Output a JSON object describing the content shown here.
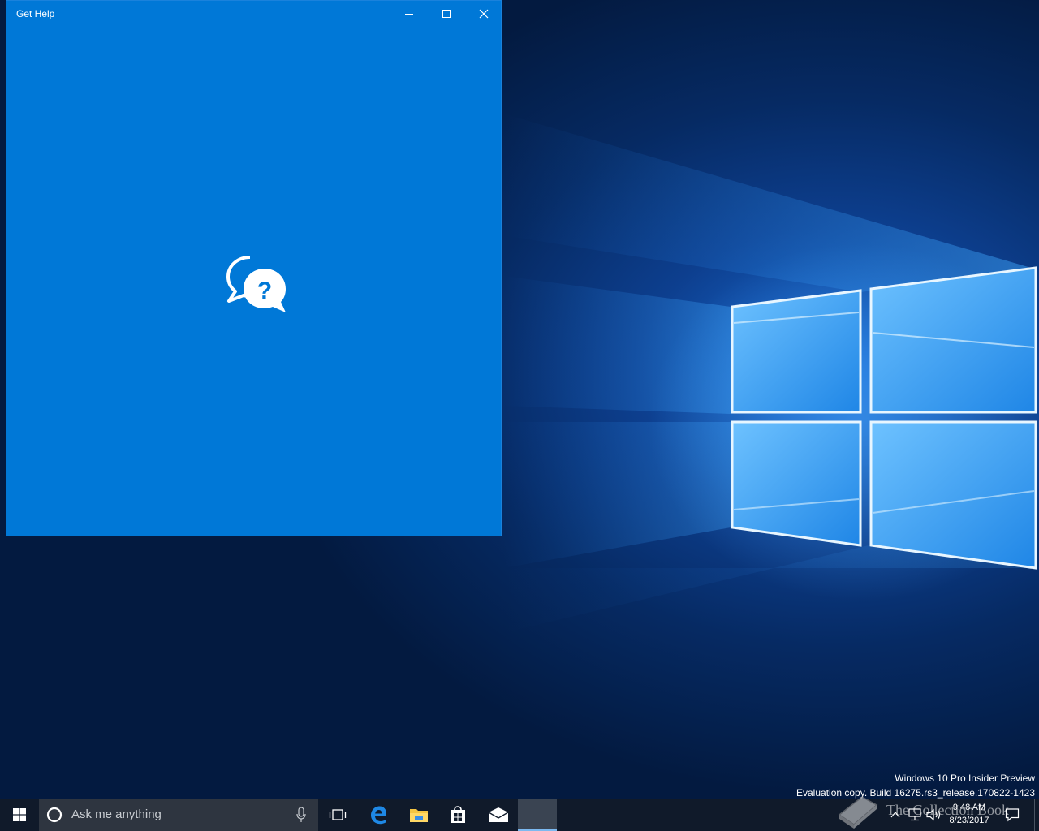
{
  "window": {
    "title": "Get Help",
    "background_color": "#0078d7",
    "controls": {
      "minimize_icon": "minimize-icon",
      "maximize_icon": "maximize-icon",
      "close_icon": "close-icon"
    },
    "splash_icon": "chat-question-icon"
  },
  "watermark": {
    "line1": "Windows 10 Pro Insider Preview",
    "line2": "Evaluation copy. Build 16275.rs3_release.170822-1423"
  },
  "taskbar": {
    "background_color": "#101a2a",
    "search": {
      "placeholder": "Ask me anything"
    },
    "pinned_apps": [
      {
        "name": "Task View",
        "icon": "task-view-icon"
      },
      {
        "name": "Microsoft Edge",
        "icon": "edge-icon"
      },
      {
        "name": "File Explorer",
        "icon": "folder-icon"
      },
      {
        "name": "Microsoft Store",
        "icon": "store-icon"
      },
      {
        "name": "Mail",
        "icon": "mail-icon"
      },
      {
        "name": "Get Help",
        "icon": "get-help-icon",
        "active": true
      }
    ],
    "tray": {
      "time": "9:48 AM",
      "date": "8/23/2017"
    }
  },
  "site_watermark": {
    "text": "The Collection Book"
  }
}
